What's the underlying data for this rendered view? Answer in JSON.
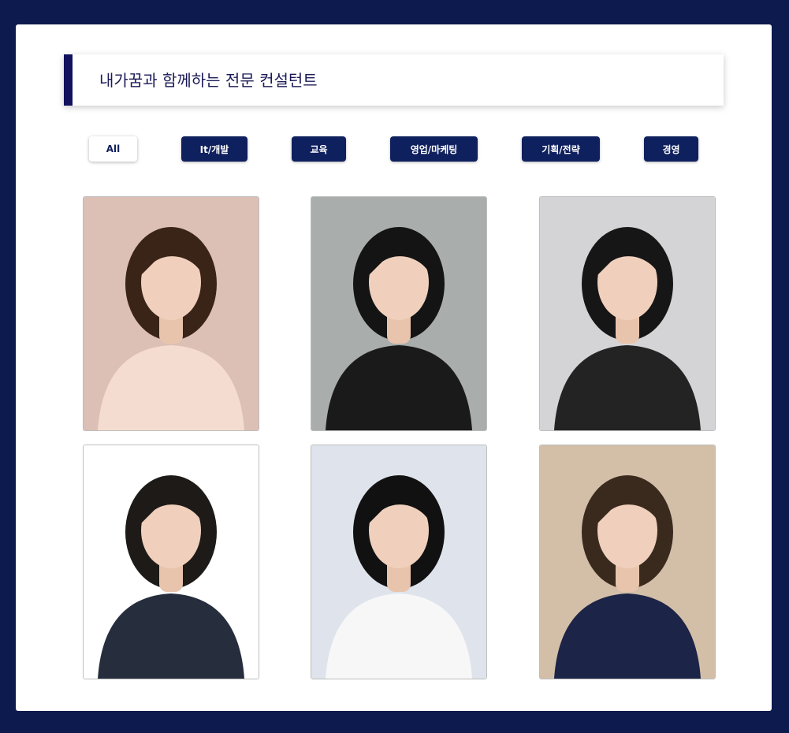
{
  "section": {
    "title": "내가꿈과 함께하는 전문 컨설턴트"
  },
  "filters": [
    {
      "label": "All",
      "active": true
    },
    {
      "label": "It/개발",
      "active": false
    },
    {
      "label": "교육",
      "active": false
    },
    {
      "label": "영업/마케팅",
      "active": false
    },
    {
      "label": "기획/전략",
      "active": false
    },
    {
      "label": "경영",
      "active": false
    }
  ],
  "consultants": [
    {
      "photo": "consultant-photo",
      "background": "#dcbfb5",
      "hair": "#3a2418",
      "clothing": "#f4ddd0"
    },
    {
      "photo": "consultant-photo",
      "background": "#a9adac",
      "hair": "#141414",
      "clothing": "#1a1a1a"
    },
    {
      "photo": "consultant-photo",
      "background": "#d4d4d6",
      "hair": "#161616",
      "clothing": "#232323"
    },
    {
      "photo": "consultant-photo",
      "background": "#ffffff",
      "hair": "#1e1a18",
      "clothing": "#262d3c"
    },
    {
      "photo": "consultant-photo",
      "background": "#dfe4ec",
      "hair": "#111111",
      "clothing": "#f7f7f7"
    },
    {
      "photo": "consultant-photo",
      "background": "#d3bfa8",
      "hair": "#3a2a1e",
      "clothing": "#1c2447"
    }
  ],
  "colors": {
    "page_background": "#0d1a4d",
    "button_background": "#0f205e",
    "title_accent": "#12115e"
  }
}
